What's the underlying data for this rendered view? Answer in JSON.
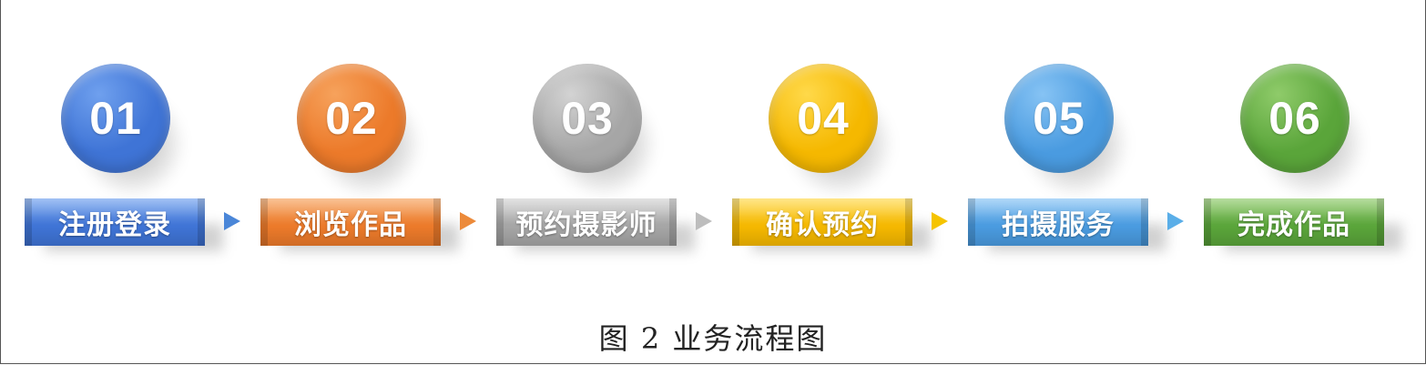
{
  "steps": [
    {
      "num": "01",
      "label": "注册登录",
      "color": "#3f74d6",
      "light": "#6fa0ee"
    },
    {
      "num": "02",
      "label": "浏览作品",
      "color": "#ec7a2a",
      "light": "#f6a25c"
    },
    {
      "num": "03",
      "label": "预约摄影师",
      "color": "#a6a6a6",
      "light": "#d3d3d3"
    },
    {
      "num": "04",
      "label": "确认预约",
      "color": "#f5b800",
      "light": "#ffd94a"
    },
    {
      "num": "05",
      "label": "拍摄服务",
      "color": "#4a9be0",
      "light": "#86c3f4"
    },
    {
      "num": "06",
      "label": "完成作品",
      "color": "#5aa53a",
      "light": "#8fcb6a"
    }
  ],
  "arrows": [
    {
      "color": "#4a86d8"
    },
    {
      "color": "#ec8a3a"
    },
    {
      "color": "#bdbdbd"
    },
    {
      "color": "#f5c400"
    },
    {
      "color": "#5aaee8"
    }
  ],
  "caption": "图 2  业务流程图"
}
